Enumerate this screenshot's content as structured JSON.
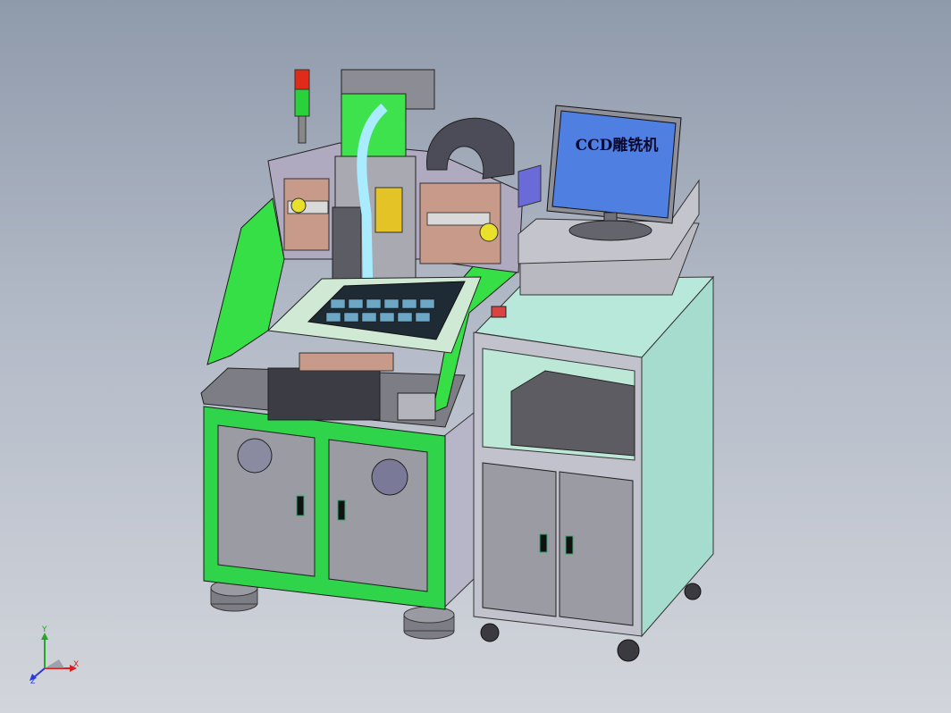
{
  "monitor": {
    "screen_text": "CCD雕铣机"
  },
  "axis_triad": {
    "x_label": "X",
    "y_label": "Y",
    "z_label": "Z"
  },
  "colors": {
    "background_top": "#8f9aab",
    "frame_green": "#2fd44b",
    "panel_gray": "#9e9ea6",
    "cabinet_mint": "#a8dfcf",
    "monitor_screen": "#4f7fe0"
  }
}
